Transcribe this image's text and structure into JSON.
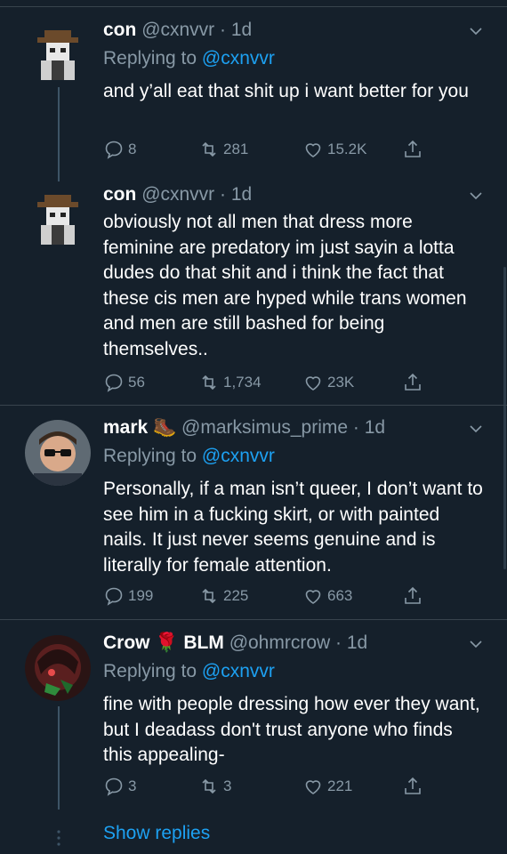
{
  "tweets": [
    {
      "name": "con",
      "handle": "@cxnvvr",
      "time": "· 1d",
      "replying_prefix": "Replying to",
      "replying_handle": "@cxnvvr",
      "text": "and y’all eat that shit up i want better for you",
      "replies": "8",
      "retweets": "281",
      "likes": "15.2K"
    },
    {
      "name": "con",
      "handle": "@cxnvvr",
      "time": "· 1d",
      "text": "obviously not all men that dress more feminine are predatory im just sayin a lotta dudes do that shit and i think the fact that these cis men are hyped while trans women and men are still bashed for being themselves..",
      "replies": "56",
      "retweets": "1,734",
      "likes": "23K"
    },
    {
      "name": "mark",
      "name_emoji": "🥾",
      "handle": "@marksimus_prime",
      "time": "· 1d",
      "replying_prefix": "Replying to",
      "replying_handle": "@cxnvvr",
      "text": "Personally, if a man isn’t queer, I don’t want to see him in a fucking skirt, or with painted nails. It just never seems genuine and is literally for female attention.",
      "replies": "199",
      "retweets": "225",
      "likes": "663"
    },
    {
      "name": "Crow",
      "name_emoji": "🌹",
      "name_suffix": "BLM",
      "handle": "@ohmrcrow",
      "time": "· 1d",
      "replying_prefix": "Replying to",
      "replying_handle": "@cxnvvr",
      "text": "fine with people dressing how ever they want, but I deadass don't trust anyone who finds this appealing-",
      "replies": "3",
      "retweets": "3",
      "likes": "221"
    }
  ],
  "show_replies": "Show replies",
  "colors": {
    "background": "#15202b",
    "text": "#ffffff",
    "secondary": "#8899a6",
    "accent": "#1da1f2",
    "border": "#38444d"
  }
}
